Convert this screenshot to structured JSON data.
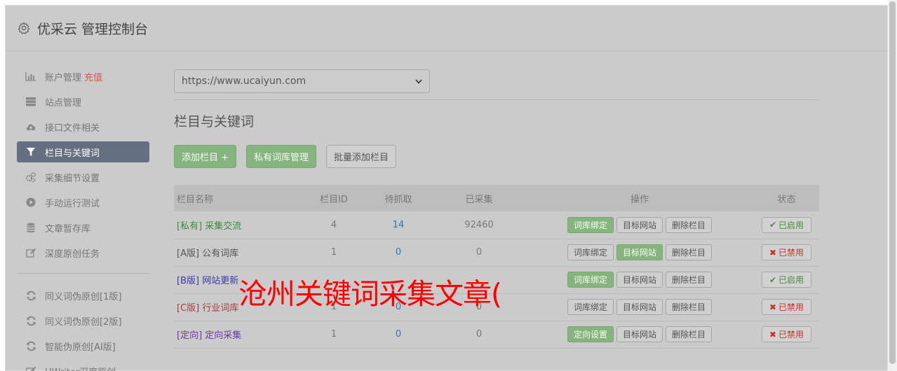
{
  "header": {
    "title": "优采云 管理控制台"
  },
  "sidebar": {
    "items": [
      {
        "label": "账户管理",
        "badge": "充值",
        "icon": "bar-chart-icon"
      },
      {
        "label": "站点管理",
        "icon": "server-icon"
      },
      {
        "label": "接口文件相关",
        "icon": "cloud-upload-icon"
      },
      {
        "label": "栏目与关键词",
        "icon": "filter-icon",
        "active": true
      },
      {
        "label": "采集细节设置",
        "icon": "gears-icon"
      },
      {
        "label": "手动运行测试",
        "icon": "play-circle-icon"
      },
      {
        "label": "文章暂存库",
        "icon": "database-icon"
      },
      {
        "label": "深度原创任务",
        "icon": "edit-icon"
      }
    ],
    "items2": [
      {
        "label": "同义词伪原创[1版]",
        "icon": "refresh-icon"
      },
      {
        "label": "同义词伪原创[2版]",
        "icon": "refresh-icon"
      },
      {
        "label": "智能伪原创[AI版]",
        "icon": "refresh-icon"
      },
      {
        "label": "UWriter深度原创",
        "icon": "edit-icon"
      }
    ]
  },
  "main": {
    "site_select": "https://www.ucaiyun.com",
    "section_title": "栏目与关键词",
    "toolbar": {
      "add": "添加栏目 +",
      "private": "私有词库管理",
      "batch": "批量添加栏目"
    },
    "table": {
      "headers": [
        "栏目名称",
        "栏目ID",
        "待抓取",
        "已采集",
        "操作",
        "状态"
      ],
      "rows": [
        {
          "tag": "[私有]",
          "name": "采集交流",
          "id": "4",
          "pending": "14",
          "collected": "92460",
          "op1": "词库绑定",
          "op2": "目标网站",
          "op3": "删除栏目",
          "status": "已启用",
          "tag_color": "#3d8b3d",
          "op1_green": true,
          "op2_green": false,
          "on": true
        },
        {
          "tag": "[A版]",
          "name": "公有词库",
          "id": "1",
          "pending": "0",
          "collected": "0",
          "op1": "词库绑定",
          "op2": "目标网站",
          "op3": "删除栏目",
          "status": "已禁用",
          "tag_color": "#555555",
          "op1_green": false,
          "op2_green": true,
          "on": false
        },
        {
          "tag": "[B版]",
          "name": "网站更新",
          "id": "",
          "pending": "",
          "collected": "",
          "op1": "词库绑定",
          "op2": "目标网站",
          "op3": "删除栏目",
          "status": "已启用",
          "tag_color": "#3a3aa6",
          "op1_green": true,
          "op2_green": false,
          "on": true
        },
        {
          "tag": "[C版]",
          "name": "行业词库",
          "id": "1",
          "pending": "0",
          "collected": "0",
          "op1": "词库绑定",
          "op2": "目标网站",
          "op3": "删除栏目",
          "status": "已禁用",
          "tag_color": "#a04040",
          "op1_green": false,
          "op2_green": false,
          "on": false
        },
        {
          "tag": "[定向]",
          "name": "定向采集",
          "id": "1",
          "pending": "0",
          "collected": "0",
          "op1": "定向设置",
          "op2": "目标网站",
          "op3": "删除栏目",
          "status": "已禁用",
          "tag_color": "#6a3aa6",
          "op1_green": true,
          "op2_green": false,
          "on": false
        }
      ]
    }
  },
  "overlay": "沧州关键词采集文章("
}
